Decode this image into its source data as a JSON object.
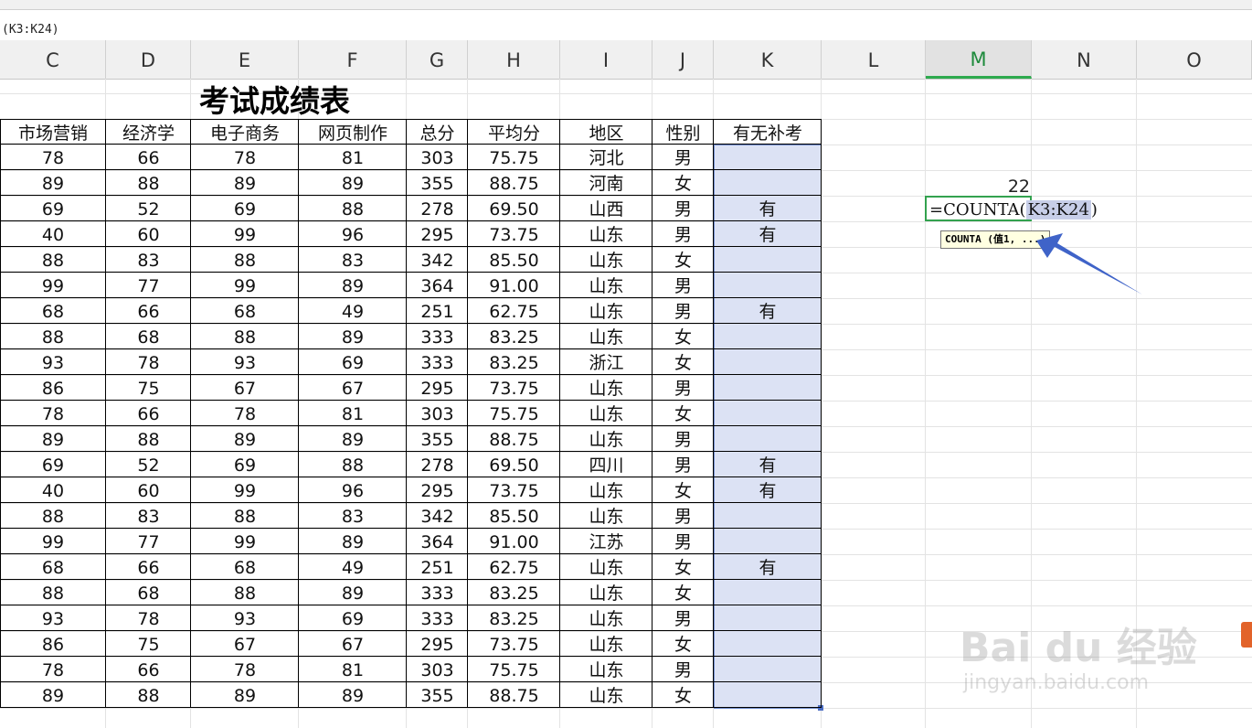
{
  "formula_bar": {
    "text": "(K3:K24)"
  },
  "columns": [
    "C",
    "D",
    "E",
    "F",
    "G",
    "H",
    "I",
    "J",
    "K",
    "L",
    "M",
    "N",
    "O"
  ],
  "active_column": "M",
  "sheet": {
    "title": "考试成绩表",
    "headers": [
      "市场营销",
      "经济学",
      "电子商务",
      "网页制作",
      "总分",
      "平均分",
      "地区",
      "性别",
      "有无补考"
    ],
    "rows": [
      [
        "78",
        "66",
        "78",
        "81",
        "303",
        "75.75",
        "河北",
        "男",
        ""
      ],
      [
        "89",
        "88",
        "89",
        "89",
        "355",
        "88.75",
        "河南",
        "女",
        ""
      ],
      [
        "69",
        "52",
        "69",
        "88",
        "278",
        "69.50",
        "山西",
        "男",
        "有"
      ],
      [
        "40",
        "60",
        "99",
        "96",
        "295",
        "73.75",
        "山东",
        "男",
        "有"
      ],
      [
        "88",
        "83",
        "88",
        "83",
        "342",
        "85.50",
        "山东",
        "女",
        ""
      ],
      [
        "99",
        "77",
        "99",
        "89",
        "364",
        "91.00",
        "山东",
        "男",
        ""
      ],
      [
        "68",
        "66",
        "68",
        "49",
        "251",
        "62.75",
        "山东",
        "男",
        "有"
      ],
      [
        "88",
        "68",
        "88",
        "89",
        "333",
        "83.25",
        "山东",
        "女",
        ""
      ],
      [
        "93",
        "78",
        "93",
        "69",
        "333",
        "83.25",
        "浙江",
        "女",
        ""
      ],
      [
        "86",
        "75",
        "67",
        "67",
        "295",
        "73.75",
        "山东",
        "男",
        ""
      ],
      [
        "78",
        "66",
        "78",
        "81",
        "303",
        "75.75",
        "山东",
        "女",
        ""
      ],
      [
        "89",
        "88",
        "89",
        "89",
        "355",
        "88.75",
        "山东",
        "男",
        ""
      ],
      [
        "69",
        "52",
        "69",
        "88",
        "278",
        "69.50",
        "四川",
        "男",
        "有"
      ],
      [
        "40",
        "60",
        "99",
        "96",
        "295",
        "73.75",
        "山东",
        "女",
        "有"
      ],
      [
        "88",
        "83",
        "88",
        "83",
        "342",
        "85.50",
        "山东",
        "男",
        ""
      ],
      [
        "99",
        "77",
        "99",
        "89",
        "364",
        "91.00",
        "江苏",
        "男",
        ""
      ],
      [
        "68",
        "66",
        "68",
        "49",
        "251",
        "62.75",
        "山东",
        "女",
        "有"
      ],
      [
        "88",
        "68",
        "88",
        "89",
        "333",
        "83.25",
        "山东",
        "女",
        ""
      ],
      [
        "93",
        "78",
        "93",
        "69",
        "333",
        "83.25",
        "山东",
        "男",
        ""
      ],
      [
        "86",
        "75",
        "67",
        "67",
        "295",
        "73.75",
        "山东",
        "女",
        ""
      ],
      [
        "78",
        "66",
        "78",
        "81",
        "303",
        "75.75",
        "山东",
        "男",
        ""
      ],
      [
        "89",
        "88",
        "89",
        "89",
        "355",
        "88.75",
        "山东",
        "女",
        ""
      ]
    ]
  },
  "cell_m": {
    "result": "22",
    "formula_prefix": "=COUNTA(",
    "formula_ref": "K3:K24",
    "formula_suffix": ")",
    "tooltip": "COUNTA (值1, ...)"
  },
  "annotation": {
    "arrow_color": "#3f63c8"
  },
  "watermark": {
    "brand": "Bai du 经验",
    "url": "jingyan.baidu.com"
  }
}
